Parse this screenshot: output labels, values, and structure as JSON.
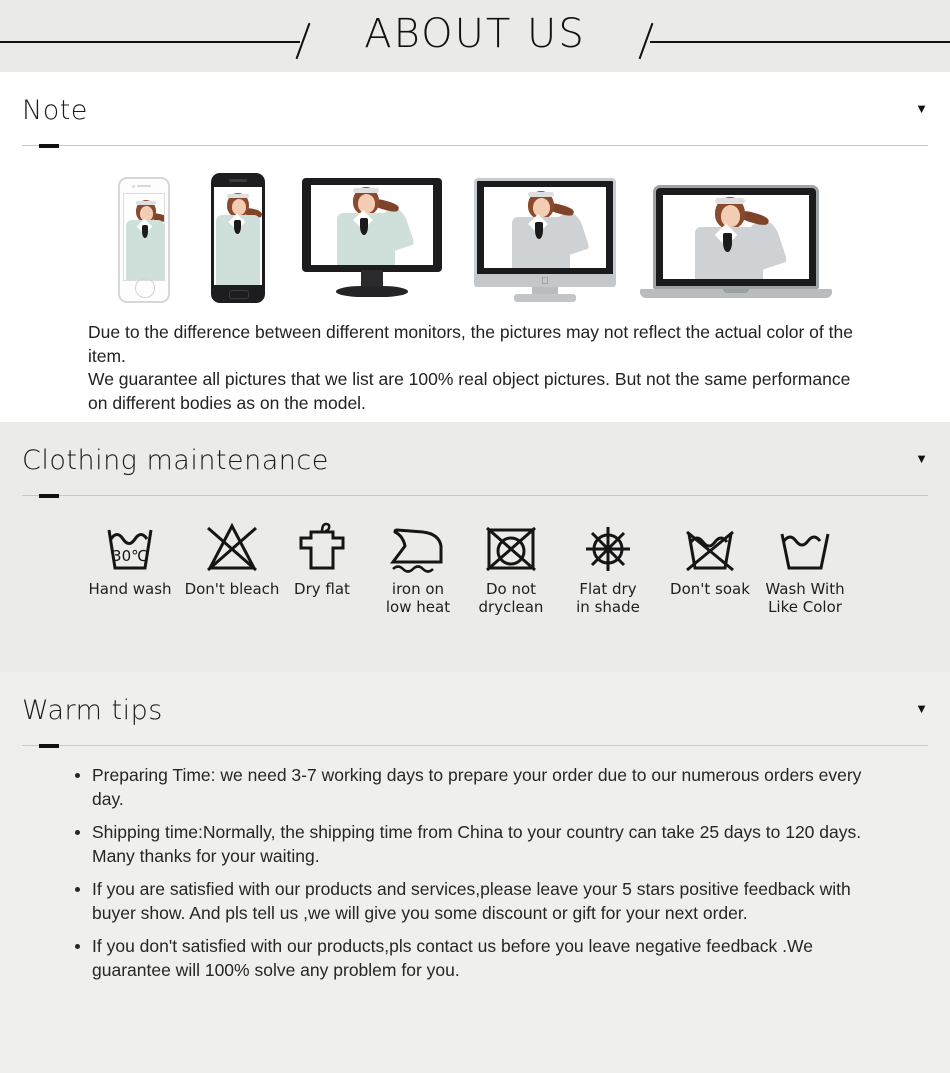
{
  "banner": {
    "title": "ABOUT US",
    "left_rule": "decorative-line",
    "right_rule": "decorative-line"
  },
  "sections": [
    {
      "id": "note",
      "heading": "Note",
      "arrow": "▼",
      "devices": [
        {
          "name": "iphone",
          "label": "iPhone"
        },
        {
          "name": "android-phone",
          "label": "Android phone"
        },
        {
          "name": "desktop-monitor",
          "label": "Monitor"
        },
        {
          "name": "imac",
          "label": "iMac"
        },
        {
          "name": "laptop",
          "label": "Laptop"
        }
      ],
      "paragraphs": [
        "Due to the difference between different monitors, the pictures may not reflect the actual color of the item.",
        "We guarantee all pictures that we list are 100% real object pictures. But not the same performance on different bodies as on the model."
      ]
    },
    {
      "id": "clothing-maintenance",
      "heading": "Clothing maintenance",
      "arrow": "▼"
    },
    {
      "id": "warm-tips",
      "heading": "Warm tips",
      "arrow": "▼"
    }
  ],
  "care_icons": [
    {
      "icon": "hand-wash-icon",
      "label": "Hand wash",
      "temp": "30℃"
    },
    {
      "icon": "do-not-bleach-icon",
      "label": "Don't bleach"
    },
    {
      "icon": "dry-flat-icon",
      "label": "Dry flat"
    },
    {
      "icon": "iron-low-heat-icon",
      "label": "iron on\nlow heat",
      "line1": "iron on",
      "line2": "low heat"
    },
    {
      "icon": "do-not-dryclean-icon",
      "label": "Do not\ndryclean",
      "line1": "Do not",
      "line2": "dryclean"
    },
    {
      "icon": "flat-dry-shade-icon",
      "label": "Flat dry\nin shade",
      "line1": "Flat dry",
      "line2": "in shade"
    },
    {
      "icon": "do-not-soak-icon",
      "label": "Don't soak"
    },
    {
      "icon": "wash-like-color-icon",
      "label": "Wash With\nLike Color",
      "line1": "Wash With",
      "line2": "Like Color"
    }
  ],
  "tips": [
    "Preparing Time: we need 3-7 working days to prepare your order due to our numerous orders every day.",
    "Shipping time:Normally, the shipping time from China to your country can take 25 days to 120 days. Many thanks for your waiting.",
    "If you are satisfied with our products and services,please leave your 5 stars positive feedback with buyer show. And pls tell us ,we will give you some discount or gift for your next order.",
    "If you don't satisfied with our products,pls contact us before you leave negative feedback .We guarantee will 100% solve any problem for you."
  ],
  "colors": {
    "banner_bg": "#eaeae8",
    "note_bg": "#ffffff",
    "care_bg": "#ebebe9",
    "tips_bg": "#efefed",
    "ink": "#111111",
    "accent_bar": "#111111",
    "rule": "#c9c9c7"
  }
}
